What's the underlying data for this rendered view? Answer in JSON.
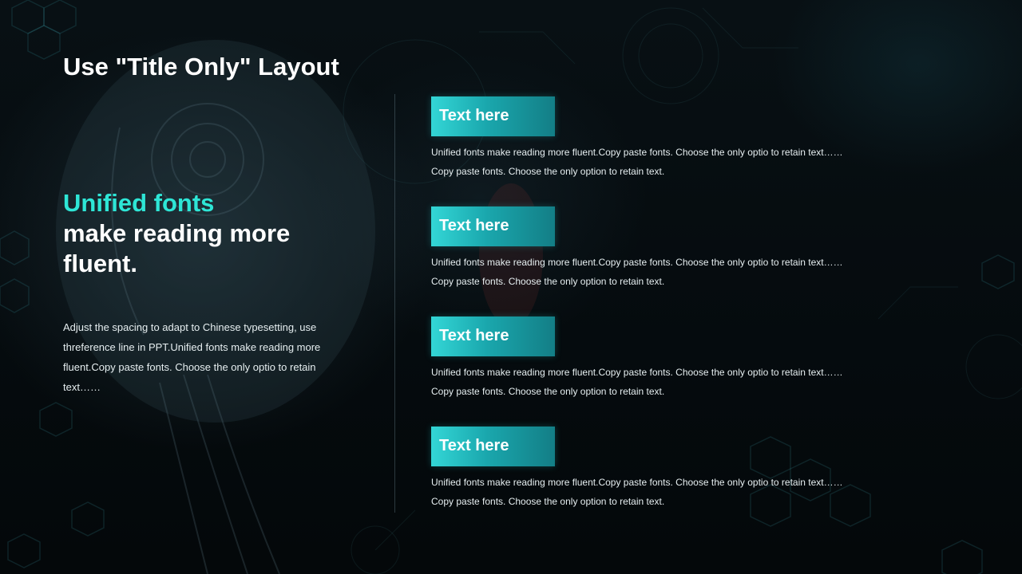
{
  "slide": {
    "title": "Use \"Title Only\" Layout",
    "headline_accent": "Unified fonts",
    "headline_rest": "make reading more fluent.",
    "body": "Adjust the spacing to adapt to Chinese typesetting, use threference line in PPT.Unified fonts make reading more fluent.Copy paste fonts. Choose the only optio to retain text……",
    "accent_color": "#2ee6d6",
    "items": [
      {
        "label": "Text here",
        "line1": "Unified  fonts make reading more fluent.Copy paste fonts. Choose the only optio to retain text……",
        "line2": "Copy paste  fonts. Choose the only option to retain text."
      },
      {
        "label": "Text here",
        "line1": "Unified  fonts make reading more fluent.Copy paste fonts. Choose the only optio to retain text……",
        "line2": "Copy paste  fonts. Choose the only option to retain text."
      },
      {
        "label": "Text here",
        "line1": "Unified  fonts make reading more fluent.Copy paste fonts. Choose the only optio to retain text……",
        "line2": "Copy paste  fonts. Choose the only option to retain text."
      },
      {
        "label": "Text here",
        "line1": "Unified  fonts make reading more fluent.Copy paste fonts. Choose the only optio to retain text……",
        "line2": "Copy paste  fonts. Choose the only option to retain text."
      }
    ]
  }
}
